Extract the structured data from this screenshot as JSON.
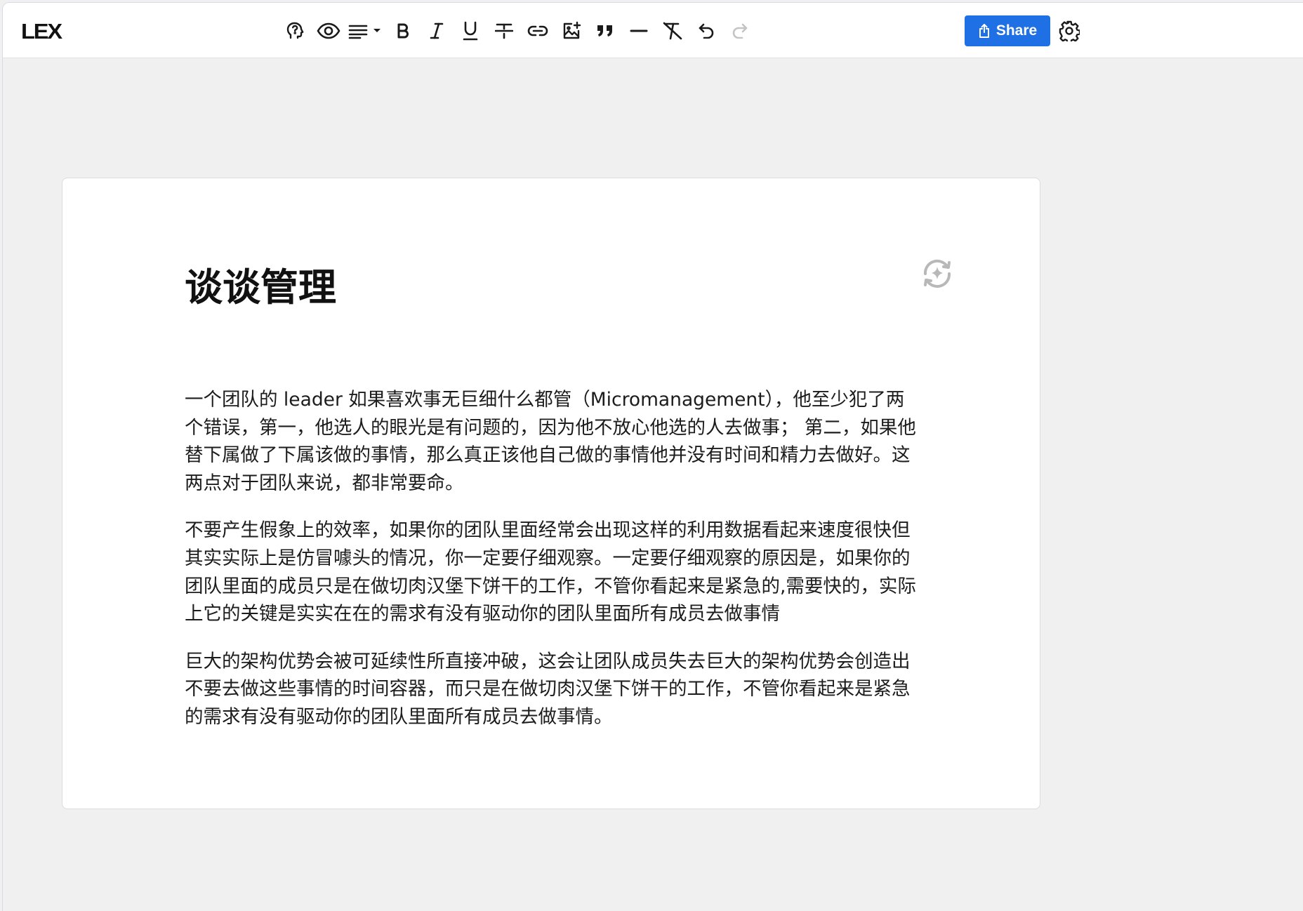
{
  "app": {
    "logo": "LEX"
  },
  "toolbar": {
    "items": [
      {
        "icon": "ai-head-icon"
      },
      {
        "icon": "eye-icon"
      },
      {
        "icon": "align-left-dropdown-icon"
      },
      {
        "icon": "bold-icon"
      },
      {
        "icon": "italic-icon"
      },
      {
        "icon": "underline-icon"
      },
      {
        "icon": "strikethrough-icon"
      },
      {
        "icon": "link-icon"
      },
      {
        "icon": "insert-image-icon"
      },
      {
        "icon": "quote-icon"
      },
      {
        "icon": "horizontal-rule-icon"
      },
      {
        "icon": "clear-format-icon"
      },
      {
        "icon": "undo-icon"
      },
      {
        "icon": "redo-icon"
      }
    ],
    "share_label": "Share"
  },
  "colors": {
    "accent": "#1f6fe5",
    "icon": "#1a1a1a",
    "icon_disabled": "#c4c4c4",
    "background": "#f0f0f0"
  },
  "document": {
    "title": "谈谈管理",
    "paragraphs": [
      "一个团队的 leader 如果喜欢事无巨细什么都管（Micromanagement），他至少犯了两个错误，第一，他选人的眼光是有问题的，因为他不放心他选的人去做事； 第二，如果他替下属做了下属该做的事情，那么真正该他自己做的事情他并没有时间和精力去做好。这两点对于团队来说，都非常要命。",
      "不要产生假象上的效率，如果你的团队里面经常会出现这样的利用数据看起来速度很快但其实实际上是仿冒噱头的情况，你一定要仔细观察。一定要仔细观察的原因是，如果你的团队里面的成员只是在做切肉汉堡下饼干的工作，不管你看起来是紧急的,需要快的，实际上它的关键是实实在在的需求有没有驱动你的团队里面所有成员去做事情",
      "巨大的架构优势会被可延续性所直接冲破，这会让团队成员失去巨大的架构优势会创造出不要去做这些事情的时间容器，而只是在做切肉汉堡下饼干的工作，不管你看起来是紧急的需求有没有驱动你的团队里面所有成员去做事情。"
    ]
  }
}
